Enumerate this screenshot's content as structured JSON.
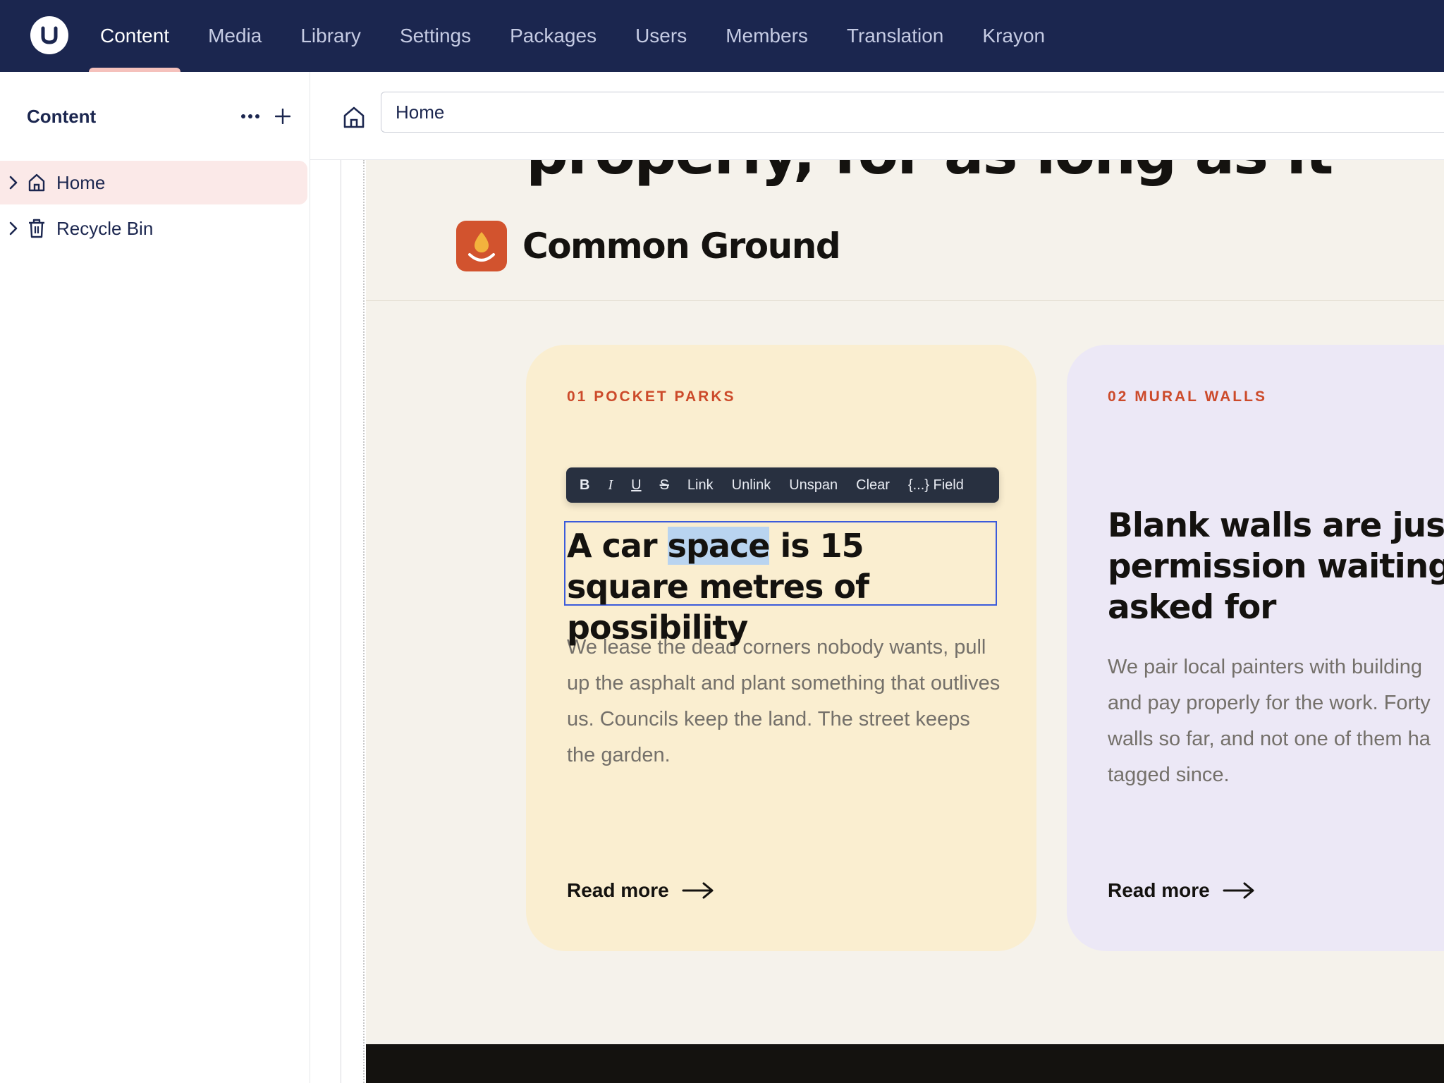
{
  "nav": {
    "items": [
      "Content",
      "Media",
      "Library",
      "Settings",
      "Packages",
      "Users",
      "Members",
      "Translation",
      "Krayon"
    ],
    "active": "Content"
  },
  "sidebar": {
    "title": "Content",
    "tree": [
      {
        "label": "Home",
        "icon": "home-icon",
        "active": true
      },
      {
        "label": "Recycle Bin",
        "icon": "trash-icon",
        "active": false
      }
    ]
  },
  "editor": {
    "name_value": "Home"
  },
  "preview": {
    "hero_fragment": "properly, for as long as it",
    "brand_name": "Common Ground",
    "cards": [
      {
        "kicker": "01 POCKET PARKS",
        "title_parts": [
          "A car ",
          "space",
          " is 15 square metres of possibility"
        ],
        "text": "We lease the dead corners nobody wants, pull up the asphalt and plant something that outlives us. Councils keep the land. The street keeps the garden.",
        "link": "Read more",
        "bg": "#faeed0"
      },
      {
        "kicker": "02 MURAL WALLS",
        "title_lines": [
          "Blank walls are just",
          "permission waiting t",
          "asked for"
        ],
        "text_lines": [
          "We pair local painters with building",
          "and pay properly for the work. Forty",
          "walls so far, and not one of them ha",
          "tagged since."
        ],
        "link": "Read more",
        "bg": "#ece8f6"
      }
    ]
  },
  "rte_toolbar": {
    "buttons": [
      "B",
      "I",
      "U",
      "S",
      "Link",
      "Unlink",
      "Unspan",
      "Clear",
      "{...} Field"
    ]
  },
  "colors": {
    "topbar": "#1b264f",
    "accent": "#f5c1bc",
    "selection_border": "#3b5bdb",
    "kicker": "#cc4a2a"
  }
}
